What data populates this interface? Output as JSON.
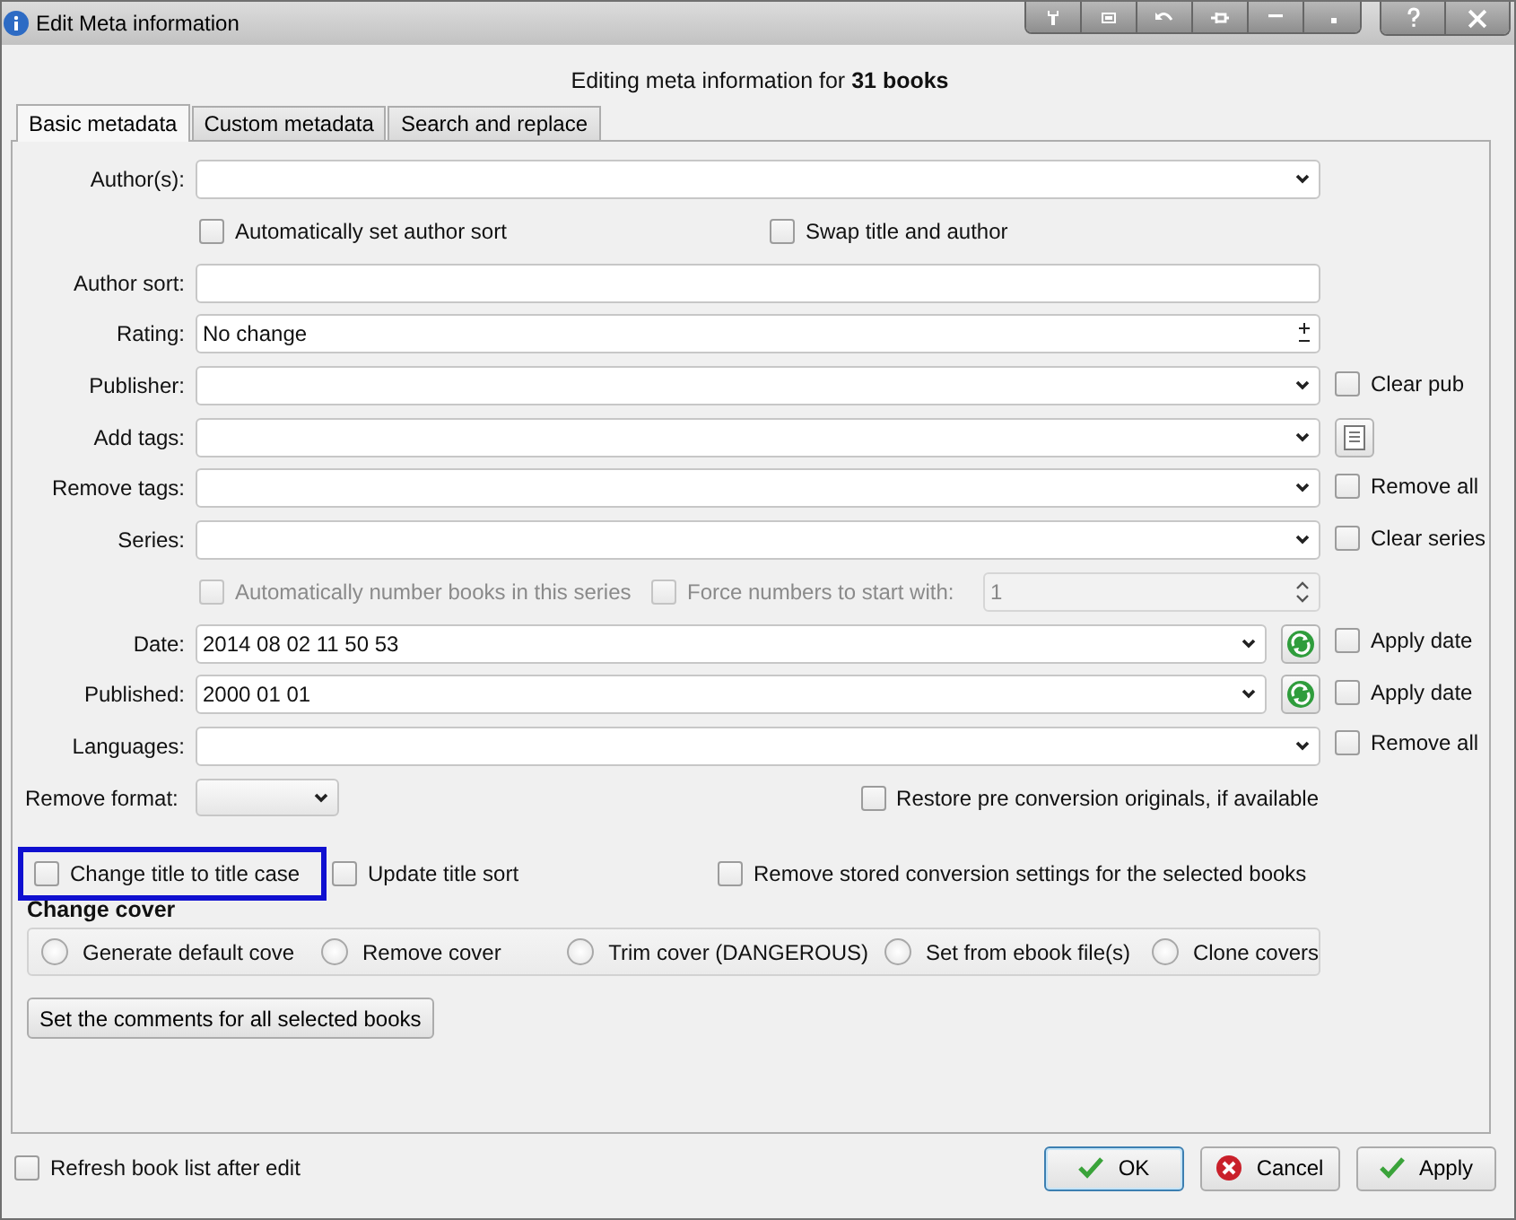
{
  "window": {
    "title": "Edit Meta information"
  },
  "heading": "Editing meta information for **31 books**",
  "tabs": [
    {
      "label": "Basic metadata",
      "selected": true
    },
    {
      "label": "Custom metadata",
      "selected": false
    },
    {
      "label": "Search and replace",
      "selected": false
    }
  ],
  "rows": [
    {
      "kind": "combo",
      "label": "Author(s):",
      "value": ""
    },
    {
      "kind": "checks",
      "items": [
        {
          "label": "Automatically set author sort",
          "checked": false,
          "disabled": false
        },
        {
          "label": "Swap title and author",
          "checked": false,
          "disabled": false
        }
      ]
    },
    {
      "kind": "text",
      "label": "Author sort:",
      "value": ""
    },
    {
      "kind": "rating",
      "label": "Rating:",
      "value": "No change"
    },
    {
      "kind": "combo",
      "label": "Publisher:",
      "value": "",
      "aside": {
        "kind": "checkbox",
        "label": "Clear pub",
        "checked": false
      }
    },
    {
      "kind": "combo",
      "label": "Add tags:",
      "value": "",
      "aside": {
        "kind": "button"
      }
    },
    {
      "kind": "combo",
      "label": "Remove tags:",
      "value": "",
      "aside": {
        "kind": "checkbox",
        "label": "Remove all",
        "checked": false
      }
    },
    {
      "kind": "combo",
      "label": "Series:",
      "value": "",
      "aside": {
        "kind": "checkbox",
        "label": "Clear series",
        "checked": false
      }
    },
    {
      "kind": "series_number",
      "items": [
        {
          "label": "Automatically number books in this series",
          "checked": false,
          "disabled": true
        },
        {
          "label": "Force numbers to start with:",
          "checked": false,
          "disabled": true
        }
      ],
      "value": "1"
    },
    {
      "kind": "date",
      "label": "Date:",
      "value": "2014 08 02 11 50 53",
      "aside": {
        "kind": "checkbox",
        "label": "Apply date",
        "checked": false
      }
    },
    {
      "kind": "date",
      "label": "Published:",
      "value": "2000 01 01",
      "aside": {
        "kind": "checkbox",
        "label": "Apply date",
        "checked": false
      }
    },
    {
      "kind": "combo",
      "label": "Languages:",
      "value": "",
      "aside": {
        "kind": "checkbox",
        "label": "Remove all",
        "checked": false
      }
    }
  ],
  "remove_format": {
    "label": "Remove format:",
    "restore": {
      "label": "Restore pre conversion originals, if available",
      "checked": false
    }
  },
  "options": [
    {
      "label": "Change title to title case",
      "checked": false,
      "highlighted": true
    },
    {
      "label": "Update title sort",
      "checked": false,
      "highlighted": false
    },
    {
      "label": "Remove stored conversion settings for the selected books",
      "checked": false,
      "highlighted": false
    }
  ],
  "cover": {
    "title": "Change cover",
    "options": [
      {
        "label": "Generate default cove",
        "selected": false
      },
      {
        "label": "Remove cover",
        "selected": false
      },
      {
        "label": "Trim cover (DANGEROUS)",
        "selected": false
      },
      {
        "label": "Set from ebook file(s)",
        "selected": false
      },
      {
        "label": "Clone covers",
        "selected": false
      }
    ]
  },
  "comments_button": "Set the comments for all selected books",
  "refresh": {
    "label": "Refresh book list after edit",
    "checked": false
  },
  "buttons": [
    {
      "kind": "ok",
      "label": "OK",
      "default": true
    },
    {
      "kind": "cancel",
      "label": "Cancel",
      "default": false
    },
    {
      "kind": "apply",
      "label": "Apply",
      "default": false
    }
  ]
}
